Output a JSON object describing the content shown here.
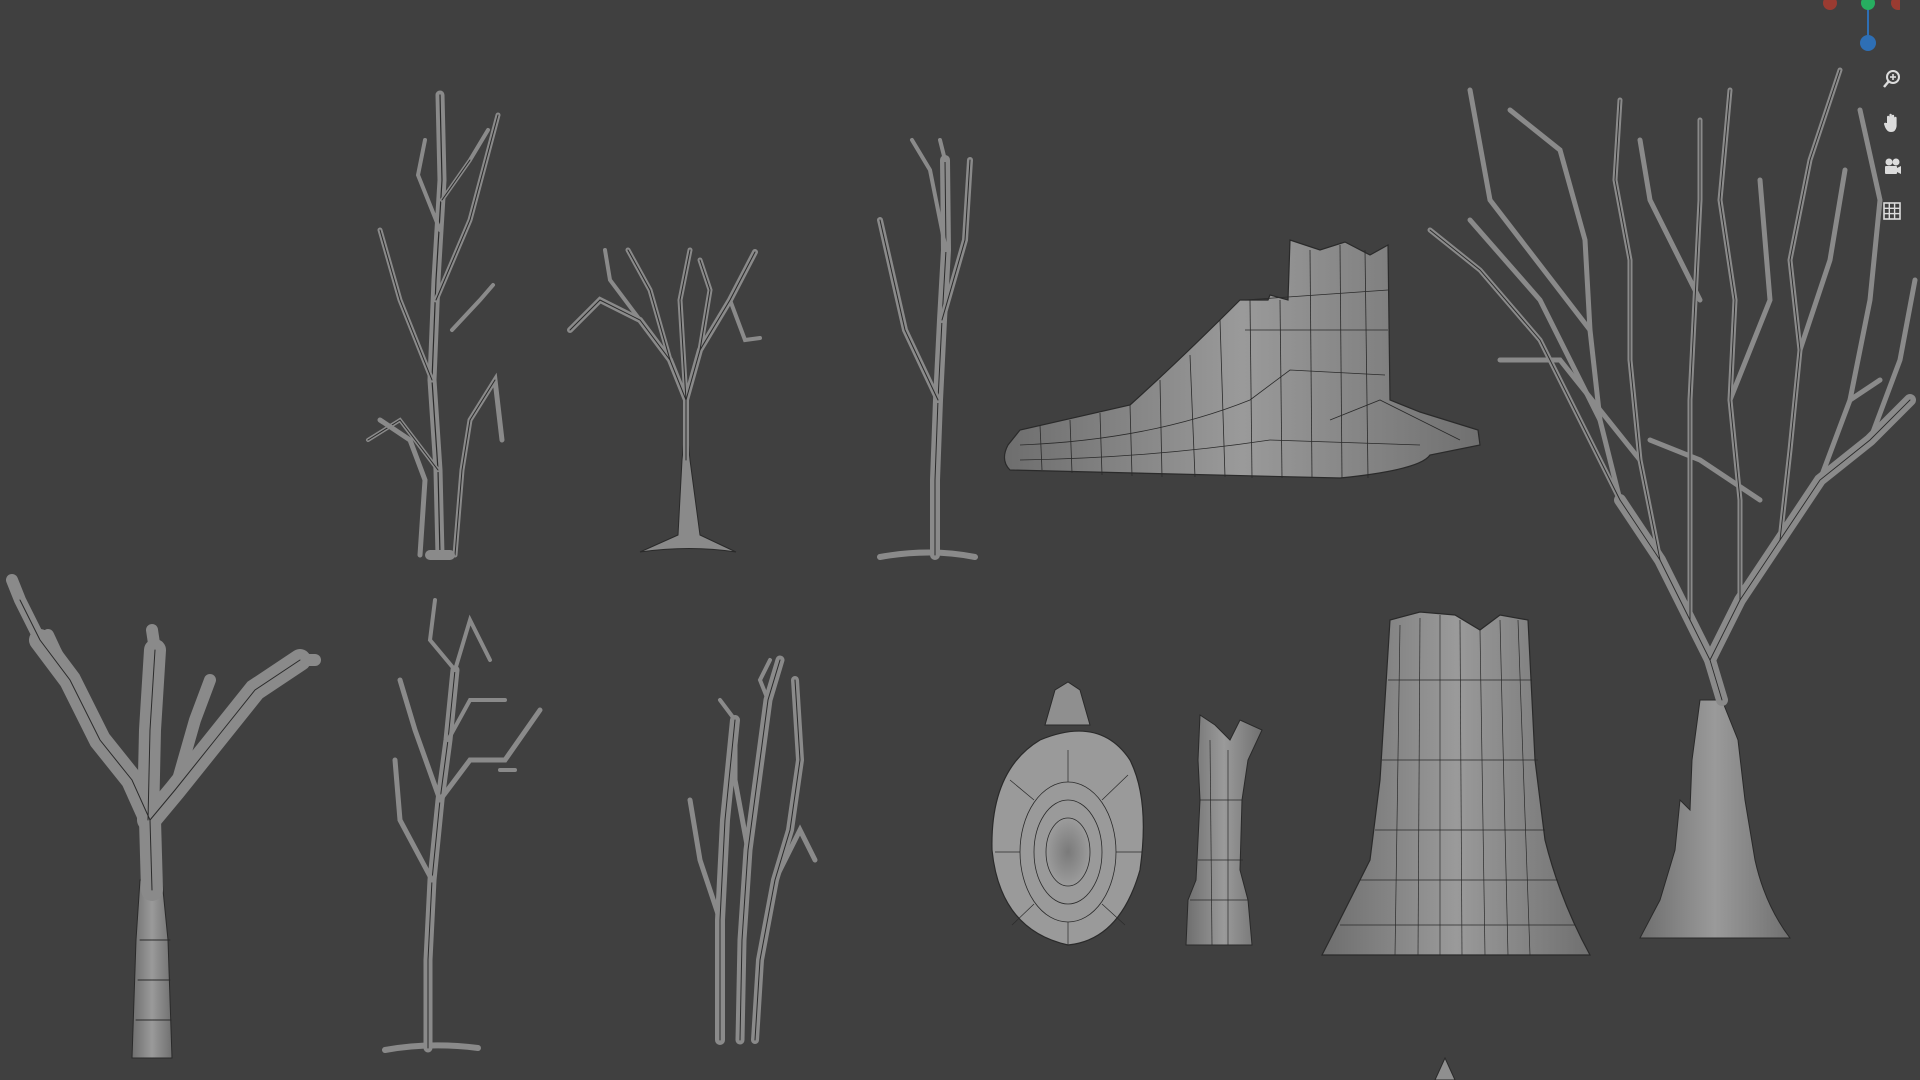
{
  "viewport": {
    "background": "#404040",
    "mesh_fill": "#8f8f8f",
    "mesh_shade": "#6f6f6f",
    "wire_color": "#2a2a2a",
    "models": [
      {
        "name": "tall-bare-tree"
      },
      {
        "name": "young-branching-tree"
      },
      {
        "name": "thin-sapling"
      },
      {
        "name": "fallen-log-stump"
      },
      {
        "name": "large-dead-tree"
      },
      {
        "name": "thick-forked-tree"
      },
      {
        "name": "slender-tree"
      },
      {
        "name": "cluster-sapling"
      },
      {
        "name": "stump-top-view"
      },
      {
        "name": "broken-post"
      },
      {
        "name": "wide-stump"
      }
    ]
  },
  "gizmo": {
    "x_color": "#c0392b",
    "y_color": "#27ae60",
    "z_color": "#2e6fb5"
  },
  "nav_tools": [
    {
      "icon": "zoom-icon"
    },
    {
      "icon": "pan-hand-icon"
    },
    {
      "icon": "camera-icon"
    },
    {
      "icon": "grid-icon"
    }
  ]
}
